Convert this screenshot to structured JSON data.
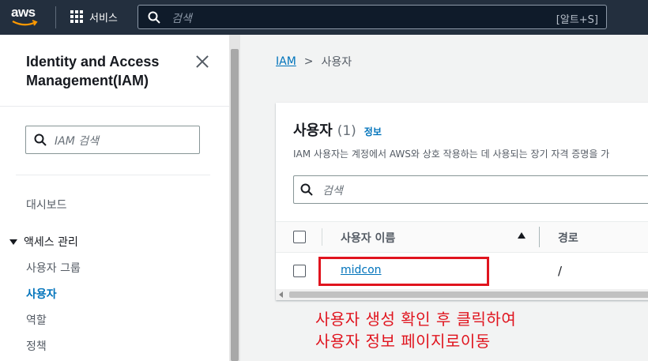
{
  "topnav": {
    "logo_text": "aws",
    "services_label": "서비스",
    "search_placeholder": "검색",
    "search_shortcut": "[알트+S]"
  },
  "sidebar": {
    "title": "Identity and Access Management(IAM)",
    "search_placeholder": "IAM 검색",
    "dashboard_label": "대시보드",
    "section_label": "액세스 관리",
    "items": [
      {
        "label": "사용자 그룹"
      },
      {
        "label": "사용자"
      },
      {
        "label": "역할"
      },
      {
        "label": "정책"
      }
    ],
    "active_item": "사용자"
  },
  "breadcrumb": {
    "root": "IAM",
    "separator": ">",
    "current": "사용자"
  },
  "panel": {
    "title": "사용자",
    "count": "(1)",
    "info_label": "정보",
    "description": "IAM 사용자는 계정에서 AWS와 상호 작용하는 데 사용되는 장기 자격 증명을 가",
    "search_placeholder": "검색",
    "columns": [
      "사용자 이름",
      "경로"
    ],
    "sort_column": "사용자 이름",
    "sort_direction": "ascending",
    "rows": [
      {
        "name": "midcon",
        "path": "/"
      }
    ]
  },
  "annotation": {
    "line1": "사용자 생성 확인 후 클릭하여",
    "line2": "사용자 정보 페이지로이동",
    "color": "#e0141e"
  }
}
